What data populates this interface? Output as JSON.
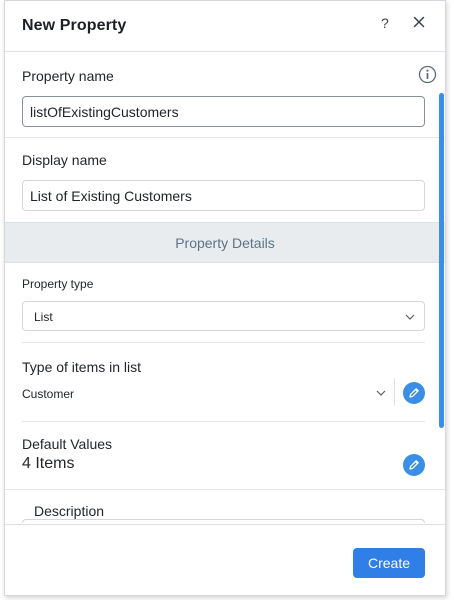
{
  "dialog": {
    "title": "New Property",
    "help_label": "?"
  },
  "fields": {
    "property_name": {
      "label": "Property name",
      "value": "listOfExistingCustomers"
    },
    "display_name": {
      "label": "Display name",
      "value": "List of Existing Customers"
    }
  },
  "section": {
    "title": "Property Details"
  },
  "property_type": {
    "label": "Property type",
    "value": "List"
  },
  "item_type": {
    "label": "Type of items in list",
    "value": "Customer"
  },
  "default_values": {
    "label": "Default Values",
    "value": "4 Items"
  },
  "description": {
    "label": "Description"
  },
  "footer": {
    "create_label": "Create"
  },
  "colors": {
    "accent": "#2f7fe6",
    "band": "#e9ecef",
    "band_text": "#5b7487"
  }
}
